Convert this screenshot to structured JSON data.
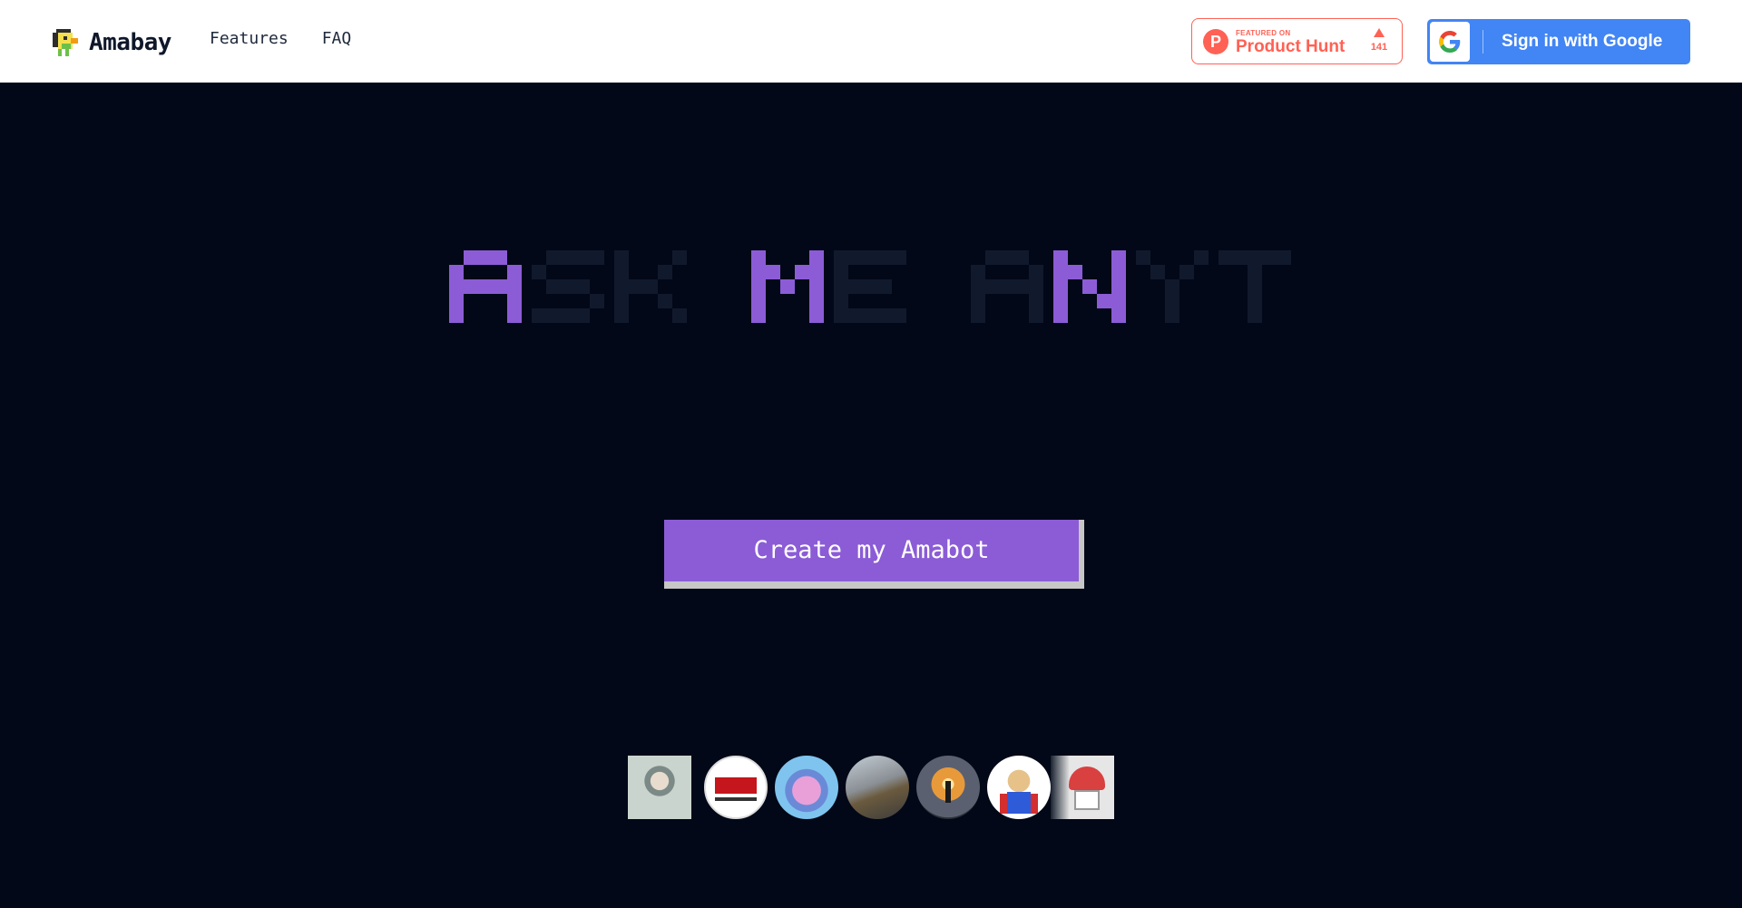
{
  "header": {
    "brand": "Amabay",
    "nav": [
      {
        "label": "Features"
      },
      {
        "label": "FAQ"
      }
    ],
    "product_hunt": {
      "small_text": "FEATURED ON",
      "big_text": "Product Hunt",
      "count": "141",
      "logo_letter": "P"
    },
    "google_signin": {
      "label": "Sign in with Google"
    }
  },
  "hero": {
    "title": "ASK ME ANYT",
    "highlighted_letters": [
      0,
      4,
      8
    ],
    "cta_label": "Create my Amabot"
  },
  "colors": {
    "page_bg": "#020817",
    "accent_purple": "#8b5cd6",
    "dim_letter": "#111a2c",
    "product_hunt": "#ff6154",
    "google_blue": "#4285f4"
  },
  "avatars": [
    {
      "name": "avatar-cartoon-man"
    },
    {
      "name": "avatar-upmp-logo"
    },
    {
      "name": "avatar-pixel-character"
    },
    {
      "name": "avatar-person-on-bench"
    },
    {
      "name": "avatar-sunset-silhouette"
    },
    {
      "name": "avatar-superhero-dog"
    },
    {
      "name": "avatar-pixel-mushroom"
    }
  ]
}
